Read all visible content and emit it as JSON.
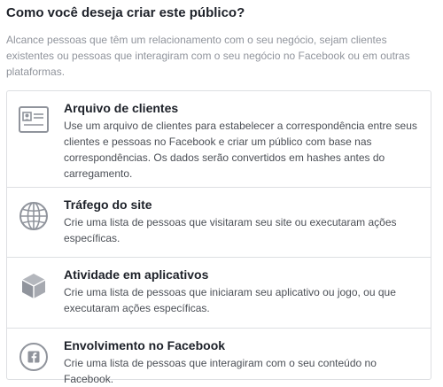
{
  "heading": "Como você deseja criar este público?",
  "description": "Alcance pessoas que têm um relacionamento com o seu negócio, sejam clientes existentes ou pessoas que interagiram com o seu negócio no Facebook ou em outras plataformas.",
  "options": [
    {
      "icon": "contact-card-icon",
      "title": "Arquivo de clientes",
      "description": "Use um arquivo de clientes para estabelecer a correspondência entre seus clientes e pessoas no Facebook e criar um público com base nas correspondências. Os dados serão convertidos em hashes antes do carregamento."
    },
    {
      "icon": "globe-icon",
      "title": "Tráfego do site",
      "description": "Crie uma lista de pessoas que visitaram seu site ou executaram ações específicas."
    },
    {
      "icon": "cube-icon",
      "title": "Atividade em aplicativos",
      "description": "Crie uma lista de pessoas que iniciaram seu aplicativo ou jogo, ou que executaram ações específicas."
    },
    {
      "icon": "facebook-icon",
      "title": "Envolvimento no Facebook",
      "description": "Crie uma lista de pessoas que interagiram com o seu conteúdo no Facebook."
    }
  ],
  "colors": {
    "icon_stroke": "#90949c",
    "border": "#dddfe2",
    "heading": "#1d2129",
    "muted_text": "#90949c",
    "body_text": "#4b4f56"
  }
}
